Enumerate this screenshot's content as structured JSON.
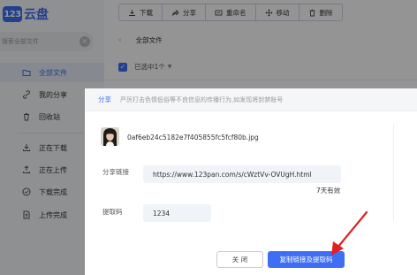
{
  "app": {
    "logo_badge": "123",
    "logo_text": "云盘"
  },
  "search": {
    "placeholder": "搜索全部文件"
  },
  "sidebar": {
    "items": [
      {
        "label": "全部文件",
        "icon": "folder-icon",
        "active": true
      },
      {
        "label": "我的分享",
        "icon": "share-link-icon",
        "active": false
      },
      {
        "label": "回收站",
        "icon": "trash-icon",
        "active": false
      },
      {
        "label": "正在下载",
        "icon": "download-tray-icon",
        "active": false
      },
      {
        "label": "正在上传",
        "icon": "upload-tray-icon",
        "active": false
      },
      {
        "label": "下载完成",
        "icon": "download-done-icon",
        "active": false
      },
      {
        "label": "上传完成",
        "icon": "upload-done-icon",
        "active": false
      }
    ]
  },
  "toolbar": {
    "buttons": [
      {
        "label": "下载",
        "icon": "download-icon"
      },
      {
        "label": "分享",
        "icon": "share-icon"
      },
      {
        "label": "重命名",
        "icon": "rename-icon"
      },
      {
        "label": "移动",
        "icon": "move-icon"
      },
      {
        "label": "删除",
        "icon": "delete-icon"
      }
    ]
  },
  "breadcrumb": {
    "back": "‹",
    "current": "全部文件"
  },
  "selection": {
    "label": "已选中1个"
  },
  "dialog": {
    "tab_label": "分享",
    "notice": "严厉打击色情低俗等不良信息的传播行为,如发现将封禁账号",
    "file_name": "0af6eb24c5182e7f405855fc5fcf80b.jpg",
    "share_link_label": "分享链接",
    "share_link_value": "https://www.123pan.com/s/cWztVv-OVUgH.html",
    "validity": "7天有效",
    "code_label": "提取码",
    "code_value": "1234",
    "close_label": "关 闭",
    "copy_label": "复制链接及提取码"
  },
  "colors": {
    "accent": "#3d6ef5",
    "annotation_arrow": "#e02020"
  }
}
